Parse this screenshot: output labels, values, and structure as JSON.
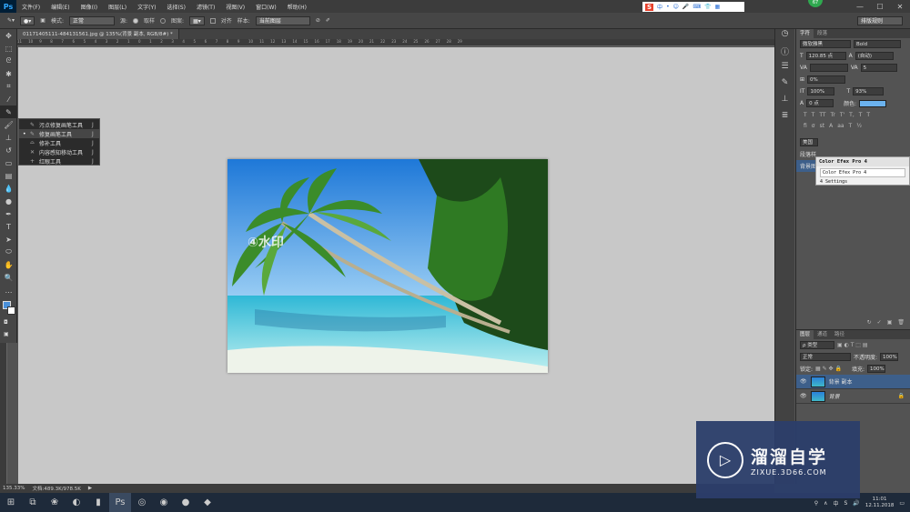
{
  "app": {
    "logo": "Ps"
  },
  "menu": [
    "文件(F)",
    "编辑(E)",
    "图像(I)",
    "图层(L)",
    "文字(Y)",
    "选择(S)",
    "滤镜(T)",
    "视图(V)",
    "窗口(W)",
    "帮助(H)"
  ],
  "window_controls": [
    "—",
    "☐",
    "✕"
  ],
  "ime_bar": {
    "logo": "S",
    "items": [
      "中",
      "•",
      "☺",
      "🎤",
      "⌨",
      "👕",
      "▦"
    ]
  },
  "badge": "67",
  "options": {
    "mode_label": "模式:",
    "mode_value": "正常",
    "source_label": "源:",
    "source_option": "取样",
    "pattern_option": "图案:",
    "align_label": "对齐",
    "sample_label": "样本:",
    "sample_value": "当前图层",
    "workspace": "排版规则"
  },
  "document": {
    "tab_title": "01171405111-484131561.jpg @ 135%(背景 副本, RGB/8#) *",
    "ruler_ticks": [
      "11",
      "10",
      "9",
      "8",
      "7",
      "6",
      "5",
      "4",
      "3",
      "2",
      "1",
      "0",
      "1",
      "2",
      "3",
      "4",
      "5",
      "6",
      "7",
      "8",
      "9",
      "10",
      "11",
      "12",
      "13",
      "14",
      "15",
      "16",
      "17",
      "18",
      "19",
      "20",
      "21",
      "22",
      "23",
      "24",
      "25",
      "26",
      "27",
      "28",
      "29"
    ],
    "watermark": "④水印"
  },
  "tool_flyout": [
    {
      "label": "污点修复画笔工具",
      "key": "J",
      "selected": false
    },
    {
      "label": "修复画笔工具",
      "key": "J",
      "selected": true
    },
    {
      "label": "修补工具",
      "key": "J",
      "selected": false
    },
    {
      "label": "内容感知移动工具",
      "key": "J",
      "selected": false
    },
    {
      "label": "红眼工具",
      "key": "J",
      "selected": false
    }
  ],
  "status": {
    "zoom": "135.33%",
    "doc": "文档:489.3K/978.5K"
  },
  "character_panel": {
    "tabs": [
      "字符",
      "段落"
    ],
    "font_family": "微软雅黑",
    "font_style": "Bold",
    "size": "120.85 点",
    "leading": "(自动)",
    "kerning": "",
    "tracking": "5",
    "scale_pct": "0%",
    "vscale": "100%",
    "hscale": "93%",
    "baseline": "0 点",
    "color_label": "颜色:",
    "color": "#6bb2ee",
    "glyph_row": [
      "T",
      "T",
      "TT",
      "Tr",
      "T'",
      "T,",
      "T",
      "T"
    ],
    "extra_tab": "美国",
    "aa_label": "段落样",
    "row_label": "背景图"
  },
  "plugin_popup": {
    "title": "Color Efex Pro 4",
    "subtitle": "Color Efex Pro 4",
    "settings": "4 Settings"
  },
  "layers_panel": {
    "tabs": [
      "图层",
      "通道",
      "路径"
    ],
    "kind": "ρ 类型",
    "blend": "正常",
    "opacity_label": "不透明度:",
    "opacity": "100%",
    "lock_label": "锁定:",
    "fill_label": "填充:",
    "fill": "100%",
    "layers": [
      {
        "name": "背景 副本",
        "active": true
      },
      {
        "name": "背景",
        "active": false
      }
    ]
  },
  "taskbar": {
    "time": "11:01",
    "date": "12.11.2018",
    "lang": "中"
  },
  "brand": {
    "title": "溜溜自学",
    "url": "ZIXUE.3D66.COM"
  }
}
